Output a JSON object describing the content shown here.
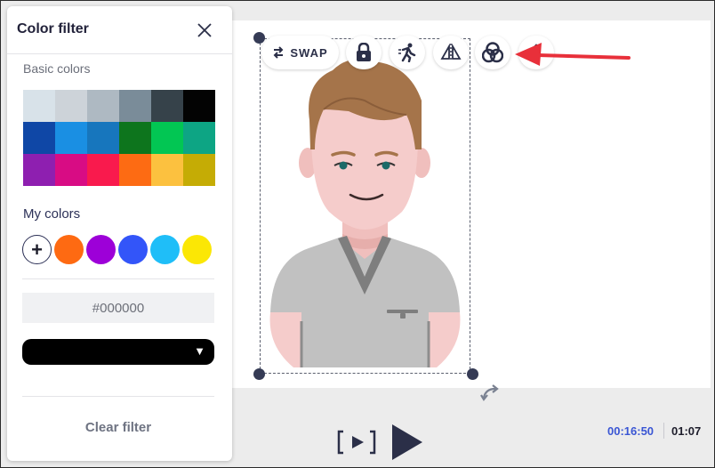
{
  "panel": {
    "title": "Color filter",
    "basic_colors_label": "Basic colors",
    "my_colors_label": "My colors",
    "add_label": "+",
    "hex_value": "#000000",
    "select_arrow": "▼",
    "clear_label": "Clear filter"
  },
  "basic_colors": [
    "#d8e2e9",
    "#cdd3d9",
    "#aeb9c2",
    "#7a8c99",
    "#36424a",
    "#030303",
    "#0f47a6",
    "#1a8fe3",
    "#1776bd",
    "#0d751d",
    "#02c653",
    "#0da584",
    "#8e1fb0",
    "#d80c84",
    "#f91a4d",
    "#fd6b13",
    "#fcc13f",
    "#c5ac05"
  ],
  "my_colors": [
    "#fe6a12",
    "#9d00d8",
    "#3355f9",
    "#1fbef8",
    "#fbe705"
  ],
  "toolbar": {
    "swap_label": "SWAP"
  },
  "timeline": {
    "current_time": "00:16:50",
    "total_time": "01:07"
  },
  "colors": {
    "accent_blue": "#3a56d4",
    "dark": "#2b2f48",
    "arrow_red": "#e8303a"
  },
  "icons": [
    "close-icon",
    "swap-icon",
    "lock-icon",
    "motion-icon",
    "flip-icon",
    "color-filter-icon",
    "move-icon",
    "rotate-icon",
    "preview-icon",
    "play-icon"
  ]
}
